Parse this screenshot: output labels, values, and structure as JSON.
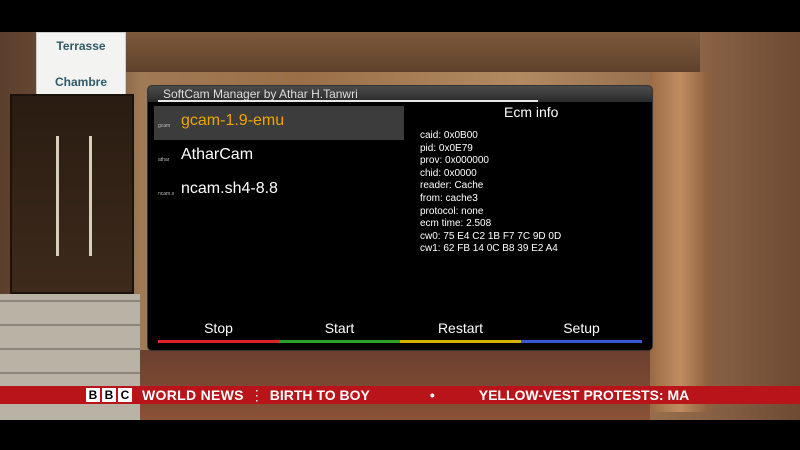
{
  "scene": {
    "sign_line1": "Terrasse",
    "sign_line2": "Chambre"
  },
  "ticker": {
    "logo_letters": [
      "B",
      "B",
      "C"
    ],
    "channel": "WORLD NEWS",
    "separator": "⋮",
    "headline1": "BIRTH TO BOY",
    "bullet": "•",
    "headline2": "YELLOW-VEST PROTESTS: MA"
  },
  "panel": {
    "title": "SoftCam Manager  by Athar H.Tanwri",
    "cams": [
      {
        "tiny_label": "gcam",
        "name": "gcam-1.9-emu",
        "selected": true
      },
      {
        "tiny_label": "athar",
        "name": "AtharCam",
        "selected": false
      },
      {
        "tiny_label": "ncam.s",
        "name": "ncam.sh4-8.8",
        "selected": false
      }
    ],
    "ecm": {
      "title": "Ecm info",
      "lines": [
        "caid: 0x0B00",
        "pid: 0x0E79",
        "prov: 0x000000",
        "chid: 0x0000",
        "reader: Cache",
        "from: cache3",
        "protocol: none",
        "ecm time: 2.508",
        "cw0: 75 E4 C2 1B F7 7C 9D 0D",
        "cw1: 62 FB 14 0C B8 39 E2 A4"
      ]
    },
    "buttons": [
      {
        "label": "Stop",
        "color": "#e0202a"
      },
      {
        "label": "Start",
        "color": "#2aa02a"
      },
      {
        "label": "Restart",
        "color": "#d8b400"
      },
      {
        "label": "Setup",
        "color": "#3a55d8"
      }
    ]
  }
}
